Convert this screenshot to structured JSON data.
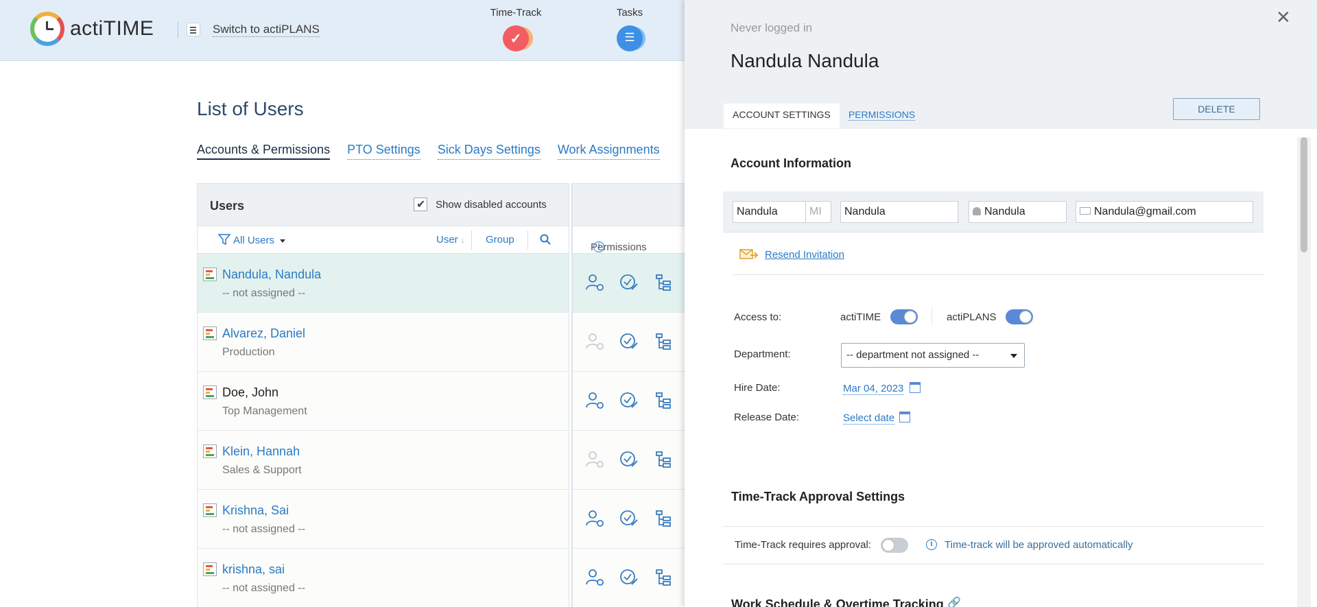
{
  "topbar": {
    "logo_text": "actiTIME",
    "switch_label": "Switch to actiPLANS",
    "nav": [
      {
        "label": "Time-Track",
        "icon": "time-track-check-icon"
      },
      {
        "label": "Tasks",
        "icon": "tasks-list-icon"
      }
    ]
  },
  "main": {
    "title": "List of Users",
    "subtabs": [
      "Accounts & Permissions",
      "PTO Settings",
      "Sick Days Settings",
      "Work Assignments"
    ],
    "users_header": "Users",
    "show_disabled_label": "Show disabled accounts",
    "filter_label": "All Users",
    "sort_user": "User",
    "sort_group": "Group",
    "permissions_label": "Permissions",
    "users": [
      {
        "name": "Nandula, Nandula",
        "dept": "-- not assigned --",
        "selected": true,
        "link": true
      },
      {
        "name": "Alvarez, Daniel",
        "dept": "Production",
        "selected": false,
        "link": true
      },
      {
        "name": "Doe, John",
        "dept": "Top Management",
        "selected": false,
        "link": false
      },
      {
        "name": "Klein, Hannah",
        "dept": "Sales & Support",
        "selected": false,
        "link": true
      },
      {
        "name": "Krishna, Sai",
        "dept": "-- not assigned --",
        "selected": false,
        "link": true
      },
      {
        "name": "krishna, sai",
        "dept": "-- not assigned --",
        "selected": false,
        "link": true
      }
    ]
  },
  "panel": {
    "status": "Never logged in",
    "name": "Nandula Nandula",
    "tabs": [
      "ACCOUNT SETTINGS",
      "PERMISSIONS"
    ],
    "delete_label": "DELETE",
    "account_info_title": "Account Information",
    "first_name": "Nandula",
    "mi_placeholder": "MI",
    "last_name": "Nandula",
    "username": "Nandula",
    "email": "Nandula@gmail.com",
    "resend_label": "Resend Invitation",
    "access_label": "Access to:",
    "access_actitime": "actiTIME",
    "access_actiplans": "actiPLANS",
    "department_label": "Department:",
    "department_value": "-- department not assigned --",
    "hire_label": "Hire Date:",
    "hire_value": "Mar 04, 2023",
    "release_label": "Release Date:",
    "release_value": "Select date",
    "approval_title": "Time-Track Approval Settings",
    "approval_label": "Time-Track requires approval:",
    "approval_info": "Time-track will be approved automatically",
    "schedule_title": "Work Schedule & Overtime Tracking"
  },
  "colors": {
    "accent_link": "#2a7ac6",
    "toggle_on": "#5a89d6",
    "selected_row": "#e3f2ef"
  }
}
